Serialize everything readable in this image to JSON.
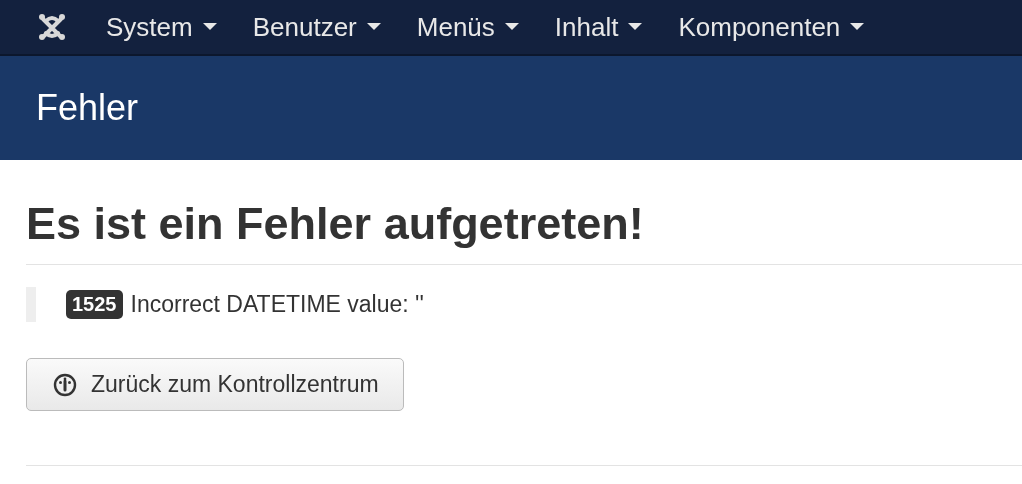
{
  "navbar": {
    "menus": [
      {
        "label": "System"
      },
      {
        "label": "Benutzer"
      },
      {
        "label": "Menüs"
      },
      {
        "label": "Inhalt"
      },
      {
        "label": "Komponenten"
      }
    ]
  },
  "header": {
    "title": "Fehler"
  },
  "content": {
    "heading": "Es ist ein Fehler aufgetreten!",
    "error": {
      "code": "1525",
      "message": "Incorrect DATETIME value: ''"
    },
    "button": "Zurück zum Kontrollzentrum"
  }
}
